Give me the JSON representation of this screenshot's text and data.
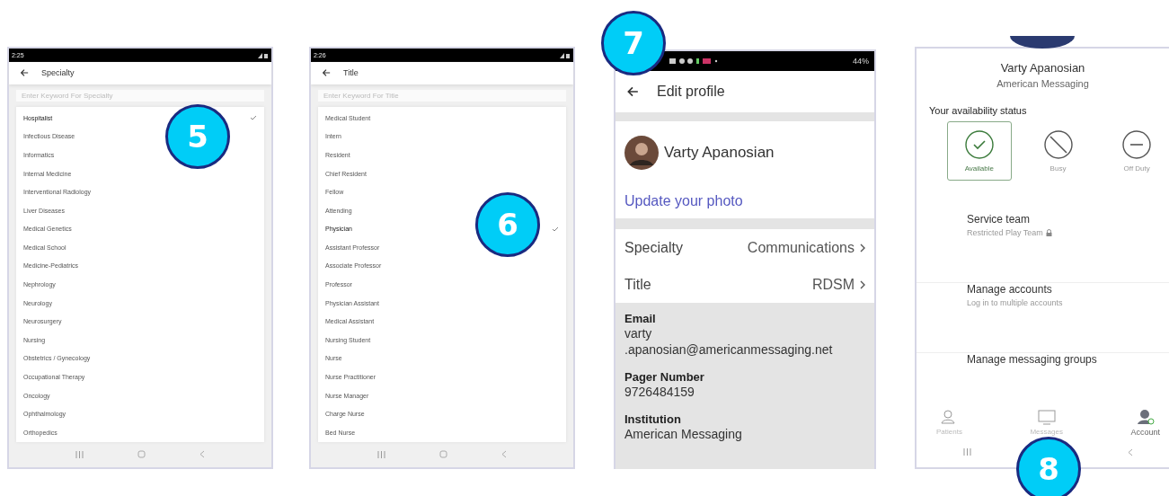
{
  "screens": [
    {
      "kind": "picker",
      "status_time": "2:25",
      "title": "Specialty",
      "search": {
        "placeholder": "Enter Keyword For Specialty"
      },
      "options": [
        {
          "label": "Hospitalist",
          "selected": true
        },
        {
          "label": "Infectious Disease",
          "selected": false
        },
        {
          "label": "Informatics",
          "selected": false
        },
        {
          "label": "Internal Medicine",
          "selected": false
        },
        {
          "label": "Interventional Radiology",
          "selected": false
        },
        {
          "label": "Liver Diseases",
          "selected": false
        },
        {
          "label": "Medical Genetics",
          "selected": false
        },
        {
          "label": "Medical School",
          "selected": false
        },
        {
          "label": "Medicine-Pediatrics",
          "selected": false
        },
        {
          "label": "Nephrology",
          "selected": false
        },
        {
          "label": "Neurology",
          "selected": false
        },
        {
          "label": "Neurosurgery",
          "selected": false
        },
        {
          "label": "Nursing",
          "selected": false
        },
        {
          "label": "Obstetrics / Gynecology",
          "selected": false
        },
        {
          "label": "Occupational Therapy",
          "selected": false
        },
        {
          "label": "Oncology",
          "selected": false
        },
        {
          "label": "Ophthalmology",
          "selected": false
        },
        {
          "label": "Orthopedics",
          "selected": false
        }
      ]
    },
    {
      "kind": "picker",
      "status_time": "2:26",
      "title": "Title",
      "search": {
        "placeholder": "Enter Keyword For Title"
      },
      "options": [
        {
          "label": "Medical Student",
          "selected": false
        },
        {
          "label": "Intern",
          "selected": false
        },
        {
          "label": "Resident",
          "selected": false
        },
        {
          "label": "Chief Resident",
          "selected": false
        },
        {
          "label": "Fellow",
          "selected": false
        },
        {
          "label": "Attending",
          "selected": false
        },
        {
          "label": "Physician",
          "selected": true
        },
        {
          "label": "Assistant Professor",
          "selected": false
        },
        {
          "label": "Associate Professor",
          "selected": false
        },
        {
          "label": "Professor",
          "selected": false
        },
        {
          "label": "Physician Assistant",
          "selected": false
        },
        {
          "label": "Medical Assistant",
          "selected": false
        },
        {
          "label": "Nursing Student",
          "selected": false
        },
        {
          "label": "Nurse",
          "selected": false
        },
        {
          "label": "Nurse Practitioner",
          "selected": false
        },
        {
          "label": "Nurse Manager",
          "selected": false
        },
        {
          "label": "Charge Nurse",
          "selected": false
        },
        {
          "label": "Bed Nurse",
          "selected": false
        }
      ]
    },
    {
      "kind": "profile",
      "battery": "44%",
      "title": "Edit profile",
      "name": "Varty Apanosian",
      "photo_link": "Update your photo",
      "fields": [
        {
          "label": "Specialty",
          "value": "Communications"
        },
        {
          "label": "Title",
          "value": "RDSM"
        }
      ],
      "details": [
        {
          "label": "Email",
          "value_lines": [
            "varty",
            ".apanosian@americanmessaging.net"
          ]
        },
        {
          "label": "Pager Number",
          "value_lines": [
            "9726484159"
          ]
        },
        {
          "label": "Institution",
          "value_lines": [
            "American Messaging"
          ]
        }
      ]
    },
    {
      "kind": "account",
      "name": "Varty Apanosian",
      "organization": "American Messaging",
      "availability_heading": "Your availability status",
      "availability": [
        {
          "kind": "available",
          "label": "Available",
          "selected": true
        },
        {
          "kind": "busy",
          "label": "Busy",
          "selected": false
        },
        {
          "kind": "off-duty",
          "label": "Off Duty",
          "selected": false
        }
      ],
      "menu": [
        {
          "title": "Service team",
          "subtitle": "Restricted Play Team",
          "locked": true
        },
        {
          "title": "Manage accounts",
          "subtitle": "Log in to multiple accounts",
          "locked": false
        },
        {
          "title": "Manage messaging groups"
        }
      ],
      "bottom_nav": [
        {
          "kind": "patients",
          "label": "Patients",
          "selected": false
        },
        {
          "kind": "messages",
          "label": "Messages",
          "selected": false
        },
        {
          "kind": "account",
          "label": "Account",
          "selected": true
        }
      ]
    }
  ],
  "badges": [
    {
      "number": "5"
    },
    {
      "number": "6"
    },
    {
      "number": "7"
    },
    {
      "number": "8"
    }
  ]
}
